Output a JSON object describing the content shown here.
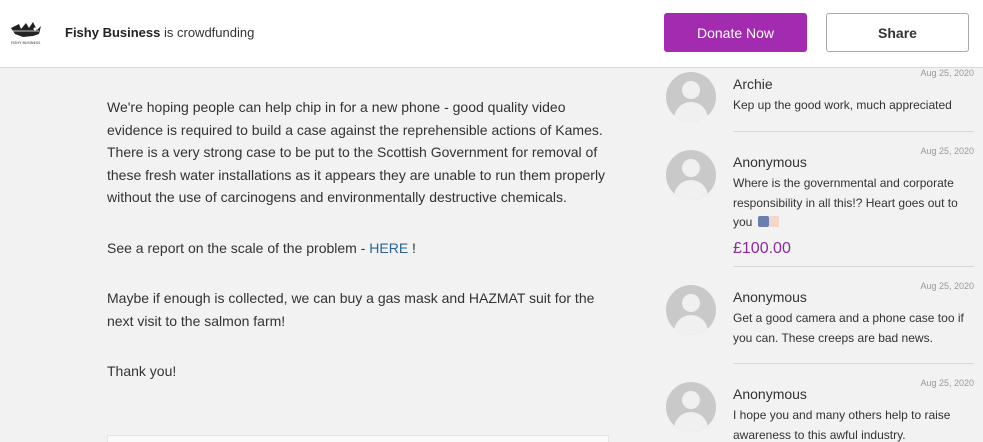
{
  "header": {
    "logo_text": "FISHY BUSINESS",
    "org_name": "Fishy Business",
    "org_suffix": "is crowdfunding",
    "donate_label": "Donate Now",
    "share_label": "Share"
  },
  "story": {
    "p1": "We're hoping people can help chip in for a new phone - good quality video evidence is required to build a case against the reprehensible actions of Kames. There is a very strong case to be put to the Scottish Government for removal of these fresh water installations as it appears they are unable to run them properly without the use of carcinogens and environmentally destructive chemicals.",
    "p2_prefix": "See a report on the scale of the problem - ",
    "p2_link": "HERE",
    "p2_suffix": " !",
    "p3": "Maybe if enough is collected, we can buy a gas mask and HAZMAT suit for the next visit to the salmon farm!",
    "p4": "Thank you!"
  },
  "donations": [
    {
      "name": "Archie",
      "date": "Aug 25, 2020",
      "message": "Kep up the good work, much appreciated",
      "amount": ""
    },
    {
      "name": "Anonymous",
      "date": "Aug 25, 2020",
      "message": "Where is the governmental and corporate responsibility in all this!? Heart goes out to you",
      "amount": "£100.00"
    },
    {
      "name": "Anonymous",
      "date": "Aug 25, 2020",
      "message": "Get a good camera and a phone case too if you can. These creeps are bad news.",
      "amount": ""
    },
    {
      "name": "Anonymous",
      "date": "Aug 25, 2020",
      "message": "I hope you and many others help to raise awareness to this awful industry.",
      "amount": ""
    }
  ],
  "colors": {
    "accent": "#a22bb0",
    "amount": "#8c2a9c",
    "link": "#2a6496"
  }
}
